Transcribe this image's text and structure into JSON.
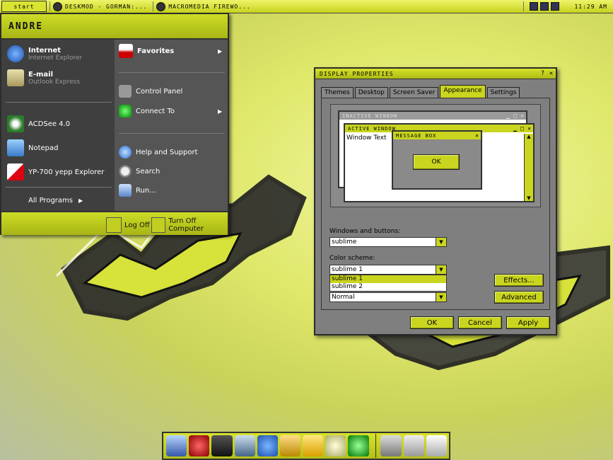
{
  "colors": {
    "accent": "#c9d51e",
    "menu_dark": "#3f3f3f",
    "menu_mid": "#555555"
  },
  "taskbar": {
    "start": "start",
    "tasks": [
      {
        "label": "DESKMOD - GORMAN:...",
        "icon": "desktop-icon"
      },
      {
        "label": "MACROMEDIA FIREWO...",
        "icon": "fireworks-icon"
      }
    ],
    "clock": "11:29 AM"
  },
  "startmenu": {
    "user": "ANDRE",
    "pinned": [
      {
        "title": "Internet",
        "sub": "Internet Explorer",
        "icon": "ie-icon"
      },
      {
        "title": "E-mail",
        "sub": "Outlook Express",
        "icon": "mail-icon"
      }
    ],
    "recent": [
      {
        "label": "ACDSee 4.0",
        "icon": "acdsee-icon"
      },
      {
        "label": "Notepad",
        "icon": "notepad-icon"
      },
      {
        "label": "YP-700 yepp Explorer",
        "icon": "yepp-icon"
      }
    ],
    "all_programs": "All Programs",
    "right": [
      {
        "label": "Favorites",
        "icon": "favorites-icon"
      },
      {
        "label": "Control Panel",
        "icon": "tools-icon"
      },
      {
        "label": "Connect To",
        "icon": "network-icon"
      },
      {
        "label": "Help and Support",
        "icon": "help-icon"
      },
      {
        "label": "Search",
        "icon": "search-icon"
      },
      {
        "label": "Run...",
        "icon": "run-icon"
      }
    ],
    "log_off": "Log Off",
    "turn_off": "Turn Off Computer"
  },
  "dialog": {
    "title": "DISPLAY PROPERTIES",
    "help": "?",
    "close": "✕",
    "tabs": [
      "Themes",
      "Desktop",
      "Screen Saver",
      "Appearance",
      "Settings"
    ],
    "active_tab": "Appearance",
    "preview": {
      "inactive_title": "INACTIVE WINDOW",
      "active_title": "ACTIVE WINDOW",
      "window_text": "Window Text",
      "msgbox_title": "MESSAGE BOX",
      "ok": "OK"
    },
    "windows_buttons_label": "Windows and buttons:",
    "windows_buttons_value": "sublime",
    "color_scheme_label": "Color scheme:",
    "color_scheme_value": "sublime 1",
    "color_scheme_options": [
      "sublime 1",
      "sublime 2"
    ],
    "font_size_value": "Normal",
    "effects": "Effects...",
    "advanced": "Advanced",
    "ok": "OK",
    "cancel": "Cancel",
    "apply": "Apply"
  },
  "dock": {
    "left": [
      "explorer-icon",
      "media-icon",
      "film-icon",
      "network-icon",
      "ie-icon",
      "pencil-icon",
      "folder-icon",
      "chat-icon",
      "recycle-icon"
    ],
    "right": [
      "monitor-icon",
      "box-icon",
      "trash-icon"
    ]
  }
}
